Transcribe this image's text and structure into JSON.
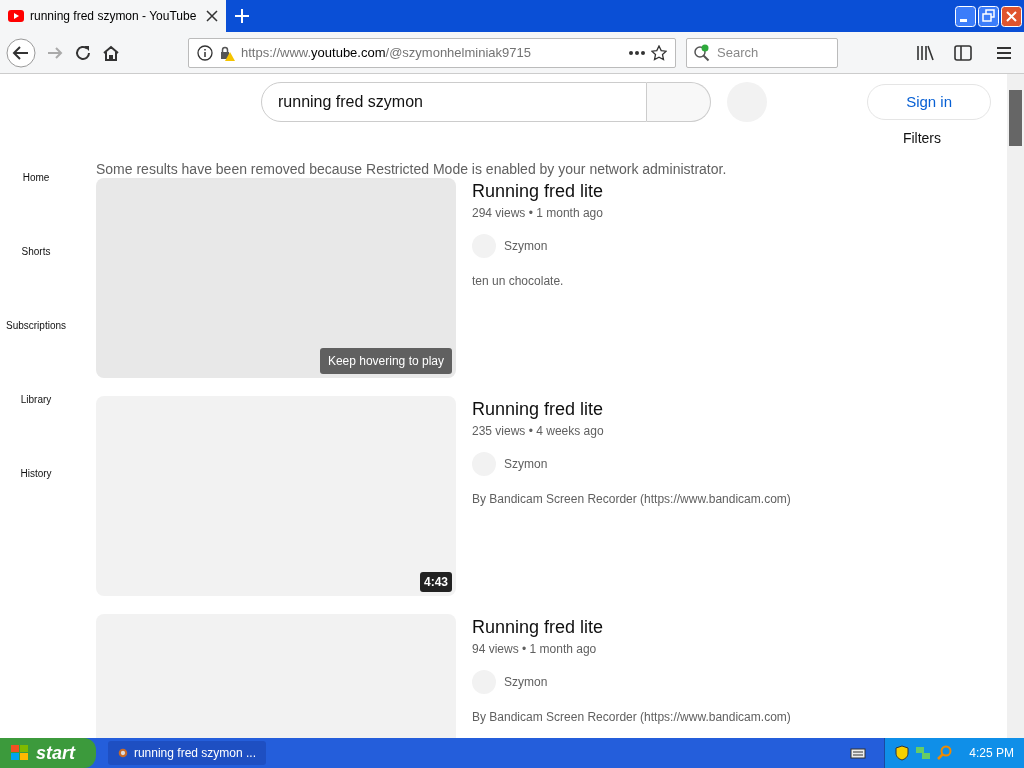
{
  "browser": {
    "tab": {
      "title": "running fred szymon - YouTube",
      "selected": true
    },
    "url": {
      "prefix": "https://www.",
      "domain": "youtube.com",
      "path": "/@szymonhelminiak9715"
    },
    "search": {
      "placeholder": "Search"
    }
  },
  "page": {
    "search_query": "running fred szymon",
    "sign_in": "Sign in",
    "filters": "Filters",
    "notice": "Some results have been removed because Restricted Mode is enabled by your network administrator.",
    "sidebar": [
      {
        "label": "Home"
      },
      {
        "label": "Shorts"
      },
      {
        "label": "Subscriptions"
      },
      {
        "label": "Library"
      },
      {
        "label": "History"
      }
    ],
    "videos": [
      {
        "title": "Running fred lite",
        "meta": "294 views • 1 month ago",
        "channel": "Szymon",
        "description": "ten un chocolate.",
        "overlay": {
          "kind": "hint",
          "text": "Keep hovering to play"
        }
      },
      {
        "title": "Running fred lite",
        "meta": "235 views • 4 weeks ago",
        "channel": "Szymon",
        "description": "By Bandicam Screen Recorder (https://www.bandicam.com)",
        "overlay": {
          "kind": "duration",
          "text": "4:43"
        }
      },
      {
        "title": "Running fred lite",
        "meta": "94 views • 1 month ago",
        "channel": "Szymon",
        "description": "By Bandicam Screen Recorder (https://www.bandicam.com)"
      }
    ]
  },
  "taskbar": {
    "start": "start",
    "task": "running fred szymon ...",
    "clock": "4:25 PM"
  }
}
